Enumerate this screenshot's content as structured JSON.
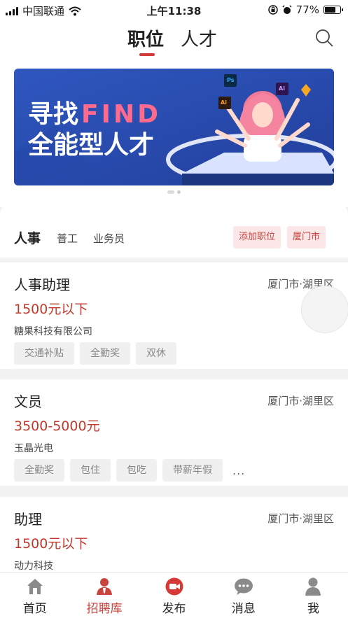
{
  "status_bar": {
    "carrier": "中国联通",
    "time": "上午11:38",
    "battery": "77%",
    "battery_level": 0.77
  },
  "header": {
    "tabs": [
      "职位",
      "人才"
    ],
    "active_tab": "职位",
    "accent": "#d33a3a"
  },
  "banner": {
    "line1_a": "寻找",
    "line1_b": "FIND",
    "line2": "全能型人才",
    "badges": [
      "Ai",
      "Ps",
      "Ai"
    ],
    "bg": "#2b50b6"
  },
  "filter": {
    "category": "人事",
    "subcategories": [
      "普工",
      "业务员"
    ],
    "add_button": "添加职位",
    "city_button": "厦门市"
  },
  "jobs": [
    {
      "title": "人事助理",
      "location": "厦门市·湖里区",
      "salary": "1500元以下",
      "company": "糖果科技有限公司",
      "tags": [
        "交通补贴",
        "全勤奖",
        "双休"
      ]
    },
    {
      "title": "文员",
      "location": "厦门市·湖里区",
      "salary": "3500-5000元",
      "company": "玉晶光电",
      "tags": [
        "全勤奖",
        "包住",
        "包吃",
        "带薪年假"
      ],
      "more": "..."
    },
    {
      "title": "助理",
      "location": "厦门市·湖里区",
      "salary": "1500元以下",
      "company": "动力科技",
      "tags": []
    }
  ],
  "tabbar": {
    "items": [
      "首页",
      "招聘库",
      "发布",
      "消息",
      "我"
    ],
    "active": "招聘库"
  }
}
